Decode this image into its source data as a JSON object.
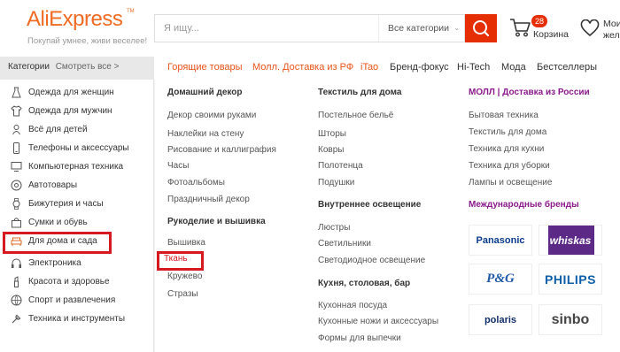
{
  "header": {
    "logo": "AliExpress",
    "logo_tm": "TM",
    "tagline": "Покупай умнее, живи веселее!",
    "search_placeholder": "Я ищу...",
    "search_category": "Все категории",
    "cart_count": "28",
    "cart_label": "Корзина",
    "wishlist_line1": "Мои",
    "wishlist_line2": "жела"
  },
  "category_bar": {
    "label": "Категории",
    "see_all": "Смотреть все >"
  },
  "top_nav": [
    "Горящие товары",
    "Молл. Доставка из РФ",
    "iTao",
    "Бренд-фокус",
    "Hi-Tech",
    "Мода",
    "Бестселлеры"
  ],
  "sidebar": {
    "items": [
      {
        "label": "Одежда для женщин",
        "icon": "dress-icon"
      },
      {
        "label": "Одежда для мужчин",
        "icon": "shirt-icon"
      },
      {
        "label": "Всё для детей",
        "icon": "baby-icon"
      },
      {
        "label": "Телефоны и аксессуары",
        "icon": "phone-icon"
      },
      {
        "label": "Компьютерная техника",
        "icon": "computer-icon"
      },
      {
        "label": "Автотовары",
        "icon": "wheel-icon"
      },
      {
        "label": "Бижутерия и часы",
        "icon": "watch-icon"
      },
      {
        "label": "Сумки и обувь",
        "icon": "bag-icon"
      },
      {
        "label": "Для дома и сада",
        "icon": "sofa-icon"
      },
      {
        "label": "Электроника",
        "icon": "headphones-icon"
      },
      {
        "label": "Красота и здоровье",
        "icon": "lipstick-icon"
      },
      {
        "label": "Спорт и развлечения",
        "icon": "ball-icon"
      },
      {
        "label": "Техника и инструменты",
        "icon": "tools-icon"
      }
    ]
  },
  "panel": {
    "col1": {
      "head1": "Домашний декор",
      "links1": [
        "Декор своими руками",
        "Наклейки на стену",
        "Рисование и каллиграфия",
        "Часы",
        "Фотоальбомы",
        "Праздничный декор"
      ],
      "head2": "Рукоделие и вышивка",
      "links2": [
        "Вышивка",
        "Ткань",
        "Кружево",
        "Стразы"
      ]
    },
    "col2": {
      "head1": "Текстиль для дома",
      "links1": [
        "Постельное бельё",
        "Шторы",
        "Ковры",
        "Полотенца",
        "Подушки"
      ],
      "head2": "Внутреннее освещение",
      "links2": [
        "Люстры",
        "Светильники",
        "Светодиодное освещение"
      ],
      "head3": "Кухня, столовая, бар",
      "links3": [
        "Кухонная посуда",
        "Кухонные ножи и аксессуары",
        "Формы для выпечки"
      ]
    },
    "col3": {
      "head1": "МОЛЛ | Доставка из России",
      "links1": [
        "Бытовая техника",
        "Текстиль для дома",
        "Техника для кухни",
        "Техника для уборки",
        "Лампы и освещение"
      ],
      "head2": "Международные бренды",
      "brands": [
        "Panasonic",
        "whiskas",
        "P&G",
        "PHILIPS",
        "polaris",
        "sinbo"
      ]
    }
  },
  "colors": {
    "accent": "#e62e04",
    "logo": "#f06b22",
    "highlight": "#d6181f",
    "mall": "#8b1a8c"
  }
}
